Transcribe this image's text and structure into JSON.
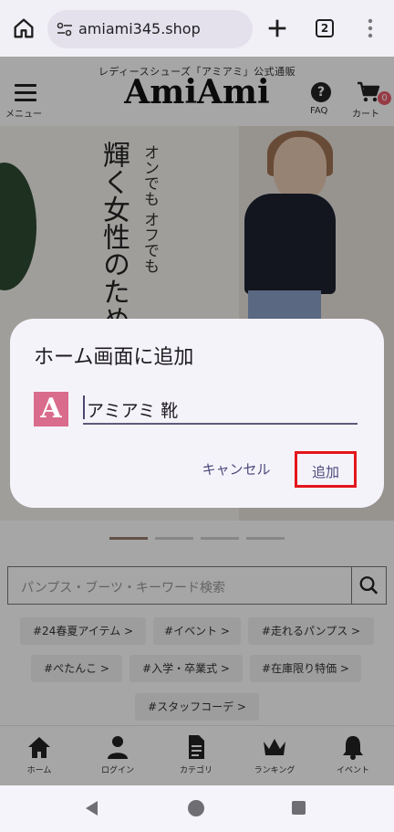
{
  "browser": {
    "url": "amiami345.shop",
    "tab_count": "2"
  },
  "site": {
    "tagline": "レディースシューズ「アミアミ」公式通販",
    "logo": "AmiAmi",
    "menu_label": "メニュー",
    "faq_label": "FAQ",
    "cart_label": "カート",
    "cart_count": "0",
    "hero_copy_main": "輝く女性のための",
    "hero_copy_sub": "オンでも オフでも",
    "search_placeholder": "パンプス・ブーツ・キーワード検索",
    "tags": [
      "#24春夏アイテム >",
      "#イベント >",
      "#走れるパンプス >",
      "#ぺたんこ >",
      "#入学・卒業式 >",
      "#在庫限り特価 >",
      "#スタッフコーデ >"
    ],
    "nav": [
      {
        "label": "ホーム",
        "icon": "home-icon"
      },
      {
        "label": "ログイン",
        "icon": "user-icon"
      },
      {
        "label": "カテゴリ",
        "icon": "document-icon"
      },
      {
        "label": "ランキング",
        "icon": "crown-icon"
      },
      {
        "label": "イベント",
        "icon": "bell-icon"
      }
    ]
  },
  "dialog": {
    "title": "ホーム画面に追加",
    "app_icon_letter": "A",
    "app_icon_color": "#d96b8c",
    "name_value": "アミアミ 靴",
    "cancel_label": "キャンセル",
    "add_label": "追加",
    "highlight_color": "#e3161b"
  }
}
